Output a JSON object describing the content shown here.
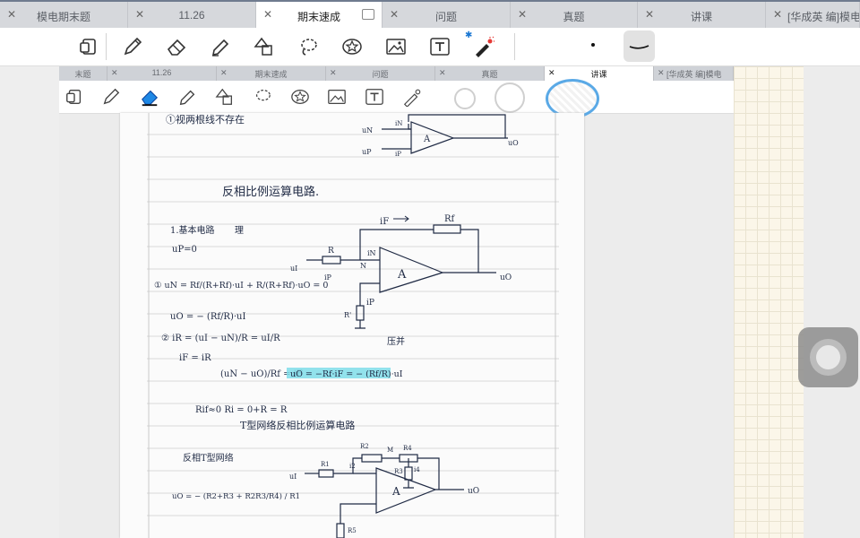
{
  "outer_tabs": [
    {
      "label": "模电期末题",
      "active": false
    },
    {
      "label": "11.26",
      "active": false
    },
    {
      "label": "期末速成",
      "active": true
    },
    {
      "label": "问题",
      "active": false
    },
    {
      "label": "真题",
      "active": false
    },
    {
      "label": "讲课",
      "active": false
    },
    {
      "label": "[华成英 编]模电",
      "active": false
    }
  ],
  "toolbar": {
    "tools": [
      "page-layout-icon",
      "pen-icon",
      "eraser-icon",
      "highlighter-icon",
      "shapes-icon",
      "lasso-icon",
      "sticker-icon",
      "image-icon",
      "text-box-icon",
      "laser-pointer-icon"
    ],
    "bluetooth_symbol": "✱"
  },
  "inner_tabs": [
    {
      "label": "末题",
      "active": false
    },
    {
      "label": "11.26",
      "active": false
    },
    {
      "label": "期末速成",
      "active": false
    },
    {
      "label": "问题",
      "active": false
    },
    {
      "label": "真题",
      "active": false
    },
    {
      "label": "讲课",
      "active": true
    },
    {
      "label": "[华成英 编]模电",
      "active": false
    }
  ],
  "notes": {
    "line1": "①视两根线不存在",
    "title": "反相比例运算电路.",
    "label_basic": "1.基本电路",
    "label_ideal": "理",
    "up0": "uP=0",
    "eq1": "① uN = Rf/(R+Rf)·uI + R/(R+Rf)·uO = 0",
    "eq2": "uO = − (Rf/R)·uI",
    "eq3": "② iR = (uI − uN)/R = uI/R",
    "eq4": "iF = iR",
    "eq5": "(uN − uO)/Rf = iF",
    "eq6": "uO = −Rf·iF = − (Rf/R)·uI",
    "note_pressure": "压并",
    "eq7": "Rif≈0   Ri = 0+R = R",
    "t_title": "T型网络反相比例运算电路",
    "t_label": "反相T型网络",
    "eq8": "uO = − (R2+R3 + R2R3/R4) / R1",
    "circuit_labels": {
      "rf": "Rf",
      "r": "R",
      "in": "iN",
      "ip": "iP",
      "if": "iF",
      "n": "N",
      "a": "A",
      "uo": "uO",
      "ui": "uI",
      "rprime": "R'",
      "r1": "R1",
      "r2": "R2",
      "r3": "R3",
      "r4": "R4",
      "r5": "R5",
      "m": "M",
      "i2": "i2",
      "i3": "i3",
      "i4": "i4",
      "un": "uN",
      "up": "uP",
      "minus": "−",
      "plus": "+"
    }
  },
  "colors": {
    "highlight": "#7fdde9",
    "ink": "#1f2a44",
    "accent": "#1976d2"
  }
}
